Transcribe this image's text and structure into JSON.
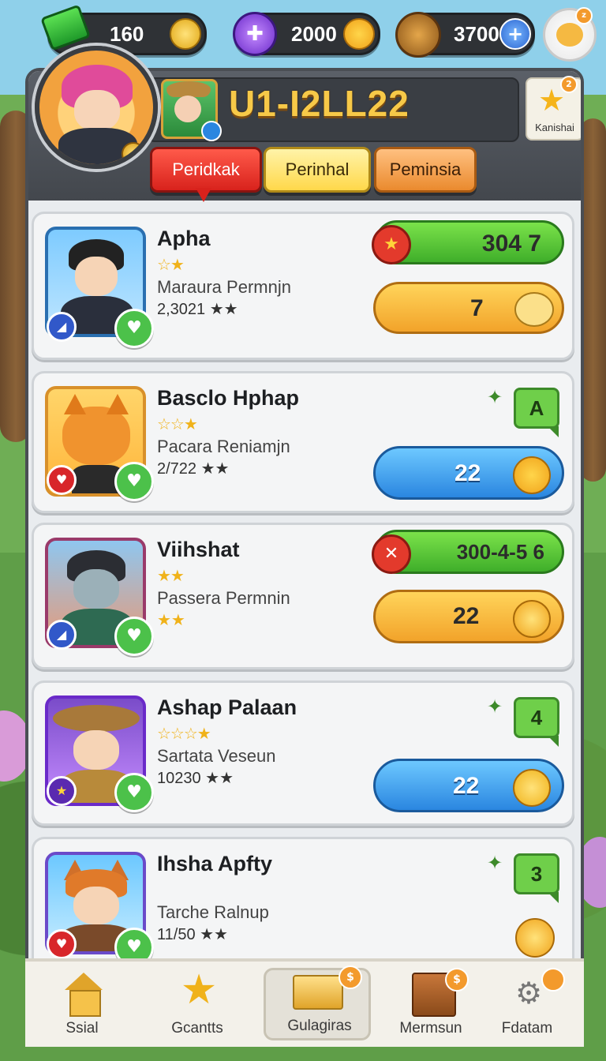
{
  "top_bar": {
    "cash": "160",
    "gems": "2000",
    "wood": "3700",
    "cash_icon": "green-cash-icon",
    "gem_icon": "purple-gem-icon",
    "wood_icon": "wood-log-icon",
    "profile_icon": "mascot-bear-icon"
  },
  "header": {
    "title": "U1-I2LL22",
    "favorite_label": "Kanishai"
  },
  "tabs": [
    {
      "label": "Peridkak"
    },
    {
      "label": "Perinhal"
    },
    {
      "label": "Peminsia"
    }
  ],
  "cards": [
    {
      "name": "Apha",
      "stars": "☆★",
      "subtitle": "Maraura Permnjn",
      "meta": "2,3021 ★★",
      "pill_top": "304 7",
      "pill_bottom": "7",
      "rank": ""
    },
    {
      "name": "Basclo Hphap",
      "stars": "☆☆★",
      "subtitle": "Pacara Reniamjn",
      "meta": "2/722 ★★",
      "pill_top": "",
      "pill_bottom": "22",
      "rank": "A"
    },
    {
      "name": "Viihshat",
      "stars": "★★",
      "subtitle": "Passera Permnin",
      "meta": "★★",
      "pill_top": "300-4-5 6",
      "pill_bottom": "22",
      "rank": ""
    },
    {
      "name": "Ashap Palaan",
      "stars": "☆☆☆★",
      "subtitle": "Sartata Veseun",
      "meta": "10230 ★★",
      "pill_top": "",
      "pill_bottom": "22",
      "rank": "4"
    },
    {
      "name": "Ihsha Apfty",
      "stars": "",
      "subtitle": "Tarche Ralnup",
      "meta": "11/50 ★★",
      "pill_top": "",
      "pill_bottom": "",
      "rank": "3"
    }
  ],
  "nav": [
    {
      "label": "Ssial",
      "icon": "house-icon"
    },
    {
      "label": "Gcantts",
      "icon": "star-icon"
    },
    {
      "label": "Gulagiras",
      "icon": "envelope-icon",
      "badge": "$"
    },
    {
      "label": "Mermsun",
      "icon": "chart-board-icon",
      "badge": "$"
    },
    {
      "label": "Fdatam",
      "icon": "settings-icon"
    }
  ],
  "colors": {
    "accent_gold": "#f7c948",
    "tab_red": "#e8342c",
    "tab_yellow": "#ffe37a",
    "tab_orange": "#f0a04a",
    "green": "#4cc14a",
    "blue": "#2a86e0"
  }
}
